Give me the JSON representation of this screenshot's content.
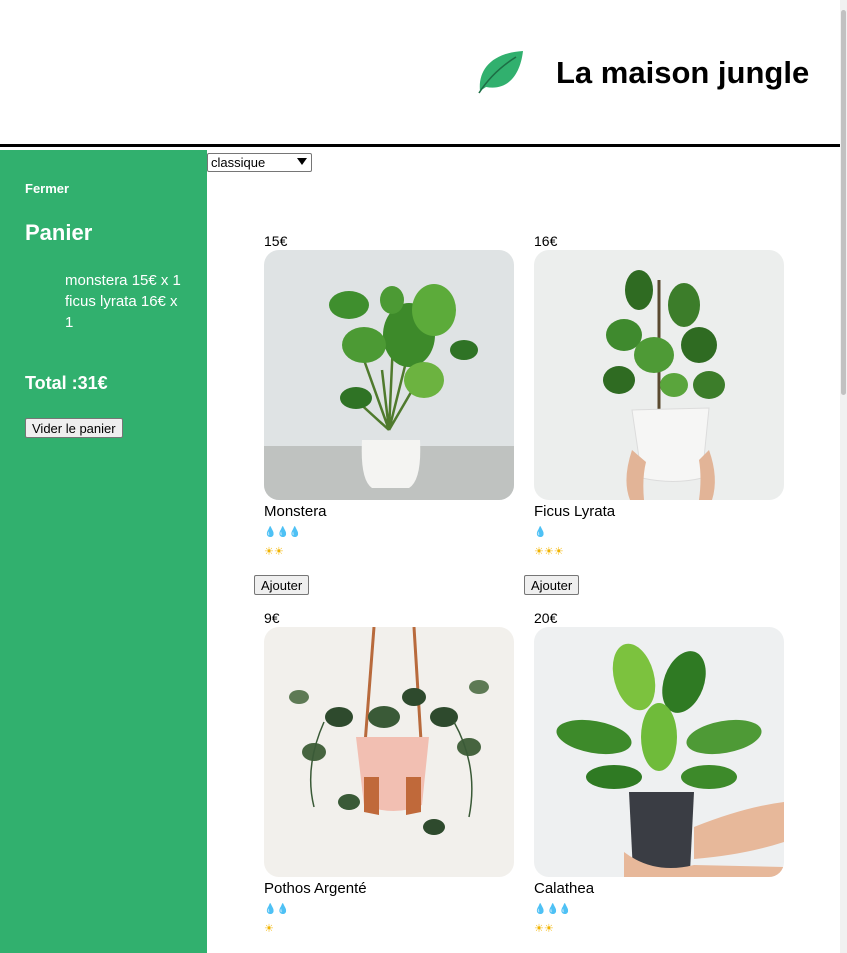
{
  "header": {
    "title": "La maison jungle"
  },
  "icons": {
    "logo": "leaf-icon",
    "water": "droplet-icon",
    "sun": "sun-icon"
  },
  "colors": {
    "sidebar": "#31b06e",
    "leaf": "#31b06e",
    "water": "#3aa0e8",
    "sun": "#f2b400"
  },
  "cart": {
    "close_label": "Fermer",
    "title": "Panier",
    "items": [
      {
        "label": "monstera 15€ x 1"
      },
      {
        "label": "ficus lyrata 16€ x 1"
      }
    ],
    "total": "Total :31€",
    "empty_label": "Vider le panier"
  },
  "filter": {
    "selected": "classique"
  },
  "products": [
    {
      "price": "15€",
      "name": "Monstera",
      "water": "💧💧💧",
      "sun": "☀☀",
      "add_label": "Ajouter"
    },
    {
      "price": "16€",
      "name": "Ficus Lyrata",
      "water": "💧",
      "sun": "☀☀☀",
      "add_label": "Ajouter"
    },
    {
      "price": "9€",
      "name": "Pothos Argenté",
      "water": "💧💧",
      "sun": "☀",
      "add_label": ""
    },
    {
      "price": "20€",
      "name": "Calathea",
      "water": "💧💧💧",
      "sun": "☀☀",
      "add_label": ""
    }
  ]
}
